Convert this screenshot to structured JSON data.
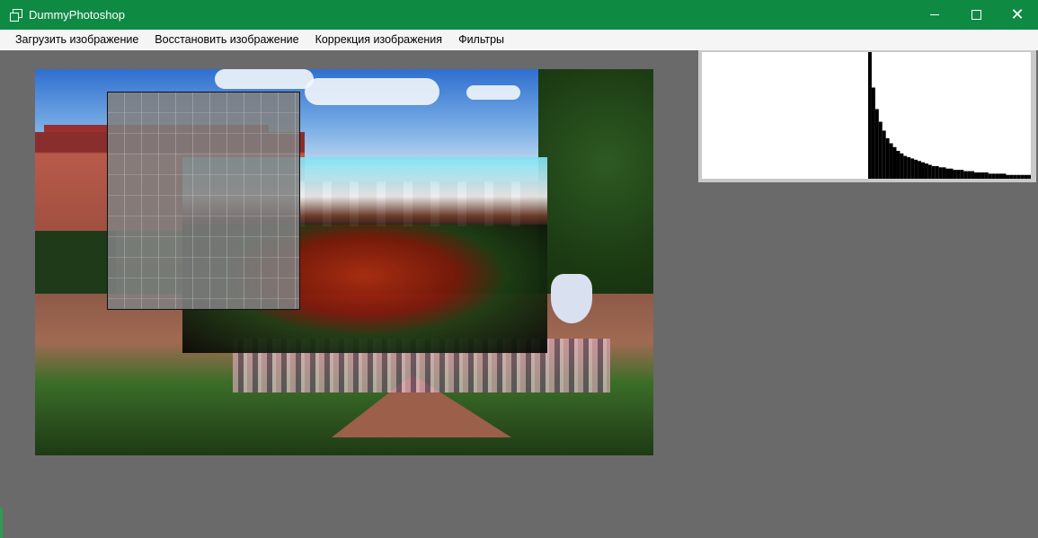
{
  "window": {
    "title": "DummyPhotoshop",
    "accent_color": "#0f8a43",
    "controls": {
      "minimize_icon": "minimize-icon",
      "maximize_icon": "maximize-icon",
      "close_icon": "close-icon",
      "close_glyph": "✕"
    }
  },
  "menu": {
    "items": [
      {
        "label": "Загрузить изображение"
      },
      {
        "label": "Восстановить изображение"
      },
      {
        "label": "Коррекция изображения"
      },
      {
        "label": "Фильтры"
      }
    ]
  },
  "workspace": {
    "background_color": "#6a6a6a",
    "image_description": "photo-of-palace-garden",
    "overlays": [
      "edge-detection-preview",
      "contrast-correction-preview"
    ]
  },
  "histogram": {
    "background_color": "#ffffff",
    "bar_color": "#000000",
    "values": [
      0,
      0,
      0,
      0,
      0,
      0,
      0,
      0,
      0,
      0,
      0,
      0,
      0,
      0,
      0,
      0,
      0,
      0,
      0,
      0,
      0,
      0,
      0,
      0,
      0,
      0,
      0,
      0,
      0,
      0,
      0,
      0,
      0,
      0,
      0,
      0,
      0,
      0,
      0,
      0,
      0,
      0,
      0,
      0,
      0,
      0,
      1.0,
      0.72,
      0.55,
      0.45,
      0.38,
      0.32,
      0.28,
      0.25,
      0.22,
      0.2,
      0.18,
      0.17,
      0.16,
      0.15,
      0.14,
      0.13,
      0.12,
      0.11,
      0.1,
      0.1,
      0.09,
      0.09,
      0.08,
      0.08,
      0.07,
      0.07,
      0.07,
      0.06,
      0.06,
      0.06,
      0.05,
      0.05,
      0.05,
      0.05,
      0.04,
      0.04,
      0.04,
      0.04,
      0.04,
      0.03,
      0.03,
      0.03,
      0.03,
      0.03,
      0.03,
      0.03
    ]
  }
}
